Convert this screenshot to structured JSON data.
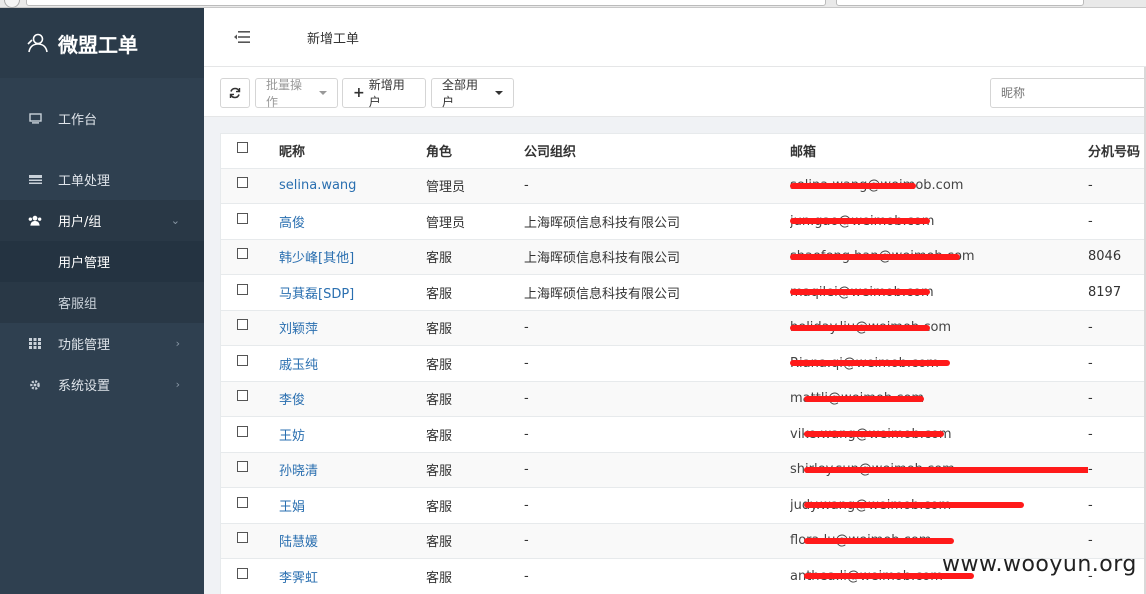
{
  "app": {
    "title": "微盟工单"
  },
  "sidebar": {
    "items": [
      {
        "label": "工作台",
        "icon": "monitor-icon"
      },
      {
        "label": "工单处理",
        "icon": "list-icon"
      },
      {
        "label": "用户/组",
        "icon": "users-icon"
      },
      {
        "label": "用户管理"
      },
      {
        "label": "客服组"
      },
      {
        "label": "功能管理",
        "icon": "grid-icon"
      },
      {
        "label": "系统设置",
        "icon": "gear-icon"
      }
    ]
  },
  "header": {
    "title": "新增工单"
  },
  "toolbar": {
    "batch_label": "批量操作",
    "add_user_label": "新增用户",
    "filter_label": "全部用户",
    "search_placeholder": "昵称"
  },
  "table": {
    "columns": [
      "昵称",
      "角色",
      "公司组织",
      "邮箱",
      "分机号码"
    ],
    "rows": [
      {
        "name": "selina.wang",
        "role": "管理员",
        "org": "-",
        "email": "selina.wang@weimob.com",
        "ext": "-"
      },
      {
        "name": "高俊",
        "role": "管理员",
        "org": "上海晖硕信息科技有限公司",
        "email": "jun.gao@weimob.com",
        "ext": "-"
      },
      {
        "name": "韩少峰[其他]",
        "role": "客服",
        "org": "上海晖硕信息科技有限公司",
        "email": "shaofeng.han@weimob.com",
        "ext": "8046"
      },
      {
        "name": "马萁磊[SDP]",
        "role": "客服",
        "org": "上海晖硕信息科技有限公司",
        "email": "maqilei@weimob.com",
        "ext": "8197"
      },
      {
        "name": "刘颖萍",
        "role": "客服",
        "org": "-",
        "email": "holiday.liu@weimob.com",
        "ext": "-"
      },
      {
        "name": "戚玉纯",
        "role": "客服",
        "org": "-",
        "email": "Riana.qi@weimob.com",
        "ext": "-"
      },
      {
        "name": "李俊",
        "role": "客服",
        "org": "-",
        "email": "mattli@weimob.com",
        "ext": "-"
      },
      {
        "name": "王妨",
        "role": "客服",
        "org": "-",
        "email": "vike.wang@weimob.com",
        "ext": "-"
      },
      {
        "name": "孙晓清",
        "role": "客服",
        "org": "-",
        "email": "shirley.sun@weimob.com",
        "ext": "-"
      },
      {
        "name": "王娟",
        "role": "客服",
        "org": "-",
        "email": "judy.wang@weimob.com",
        "ext": "-"
      },
      {
        "name": "陆慧媛",
        "role": "客服",
        "org": "-",
        "email": "flora.lu@weimob.com",
        "ext": "-"
      },
      {
        "name": "李霁虹",
        "role": "客服",
        "org": "-",
        "email": "anthea.li@weimob.com",
        "ext": "-"
      }
    ]
  },
  "watermark": "www.wooyun.org",
  "colors": {
    "sidebar_bg": "#2f4050",
    "link": "#2a6fb0",
    "redaction": "#ff1a1a"
  }
}
